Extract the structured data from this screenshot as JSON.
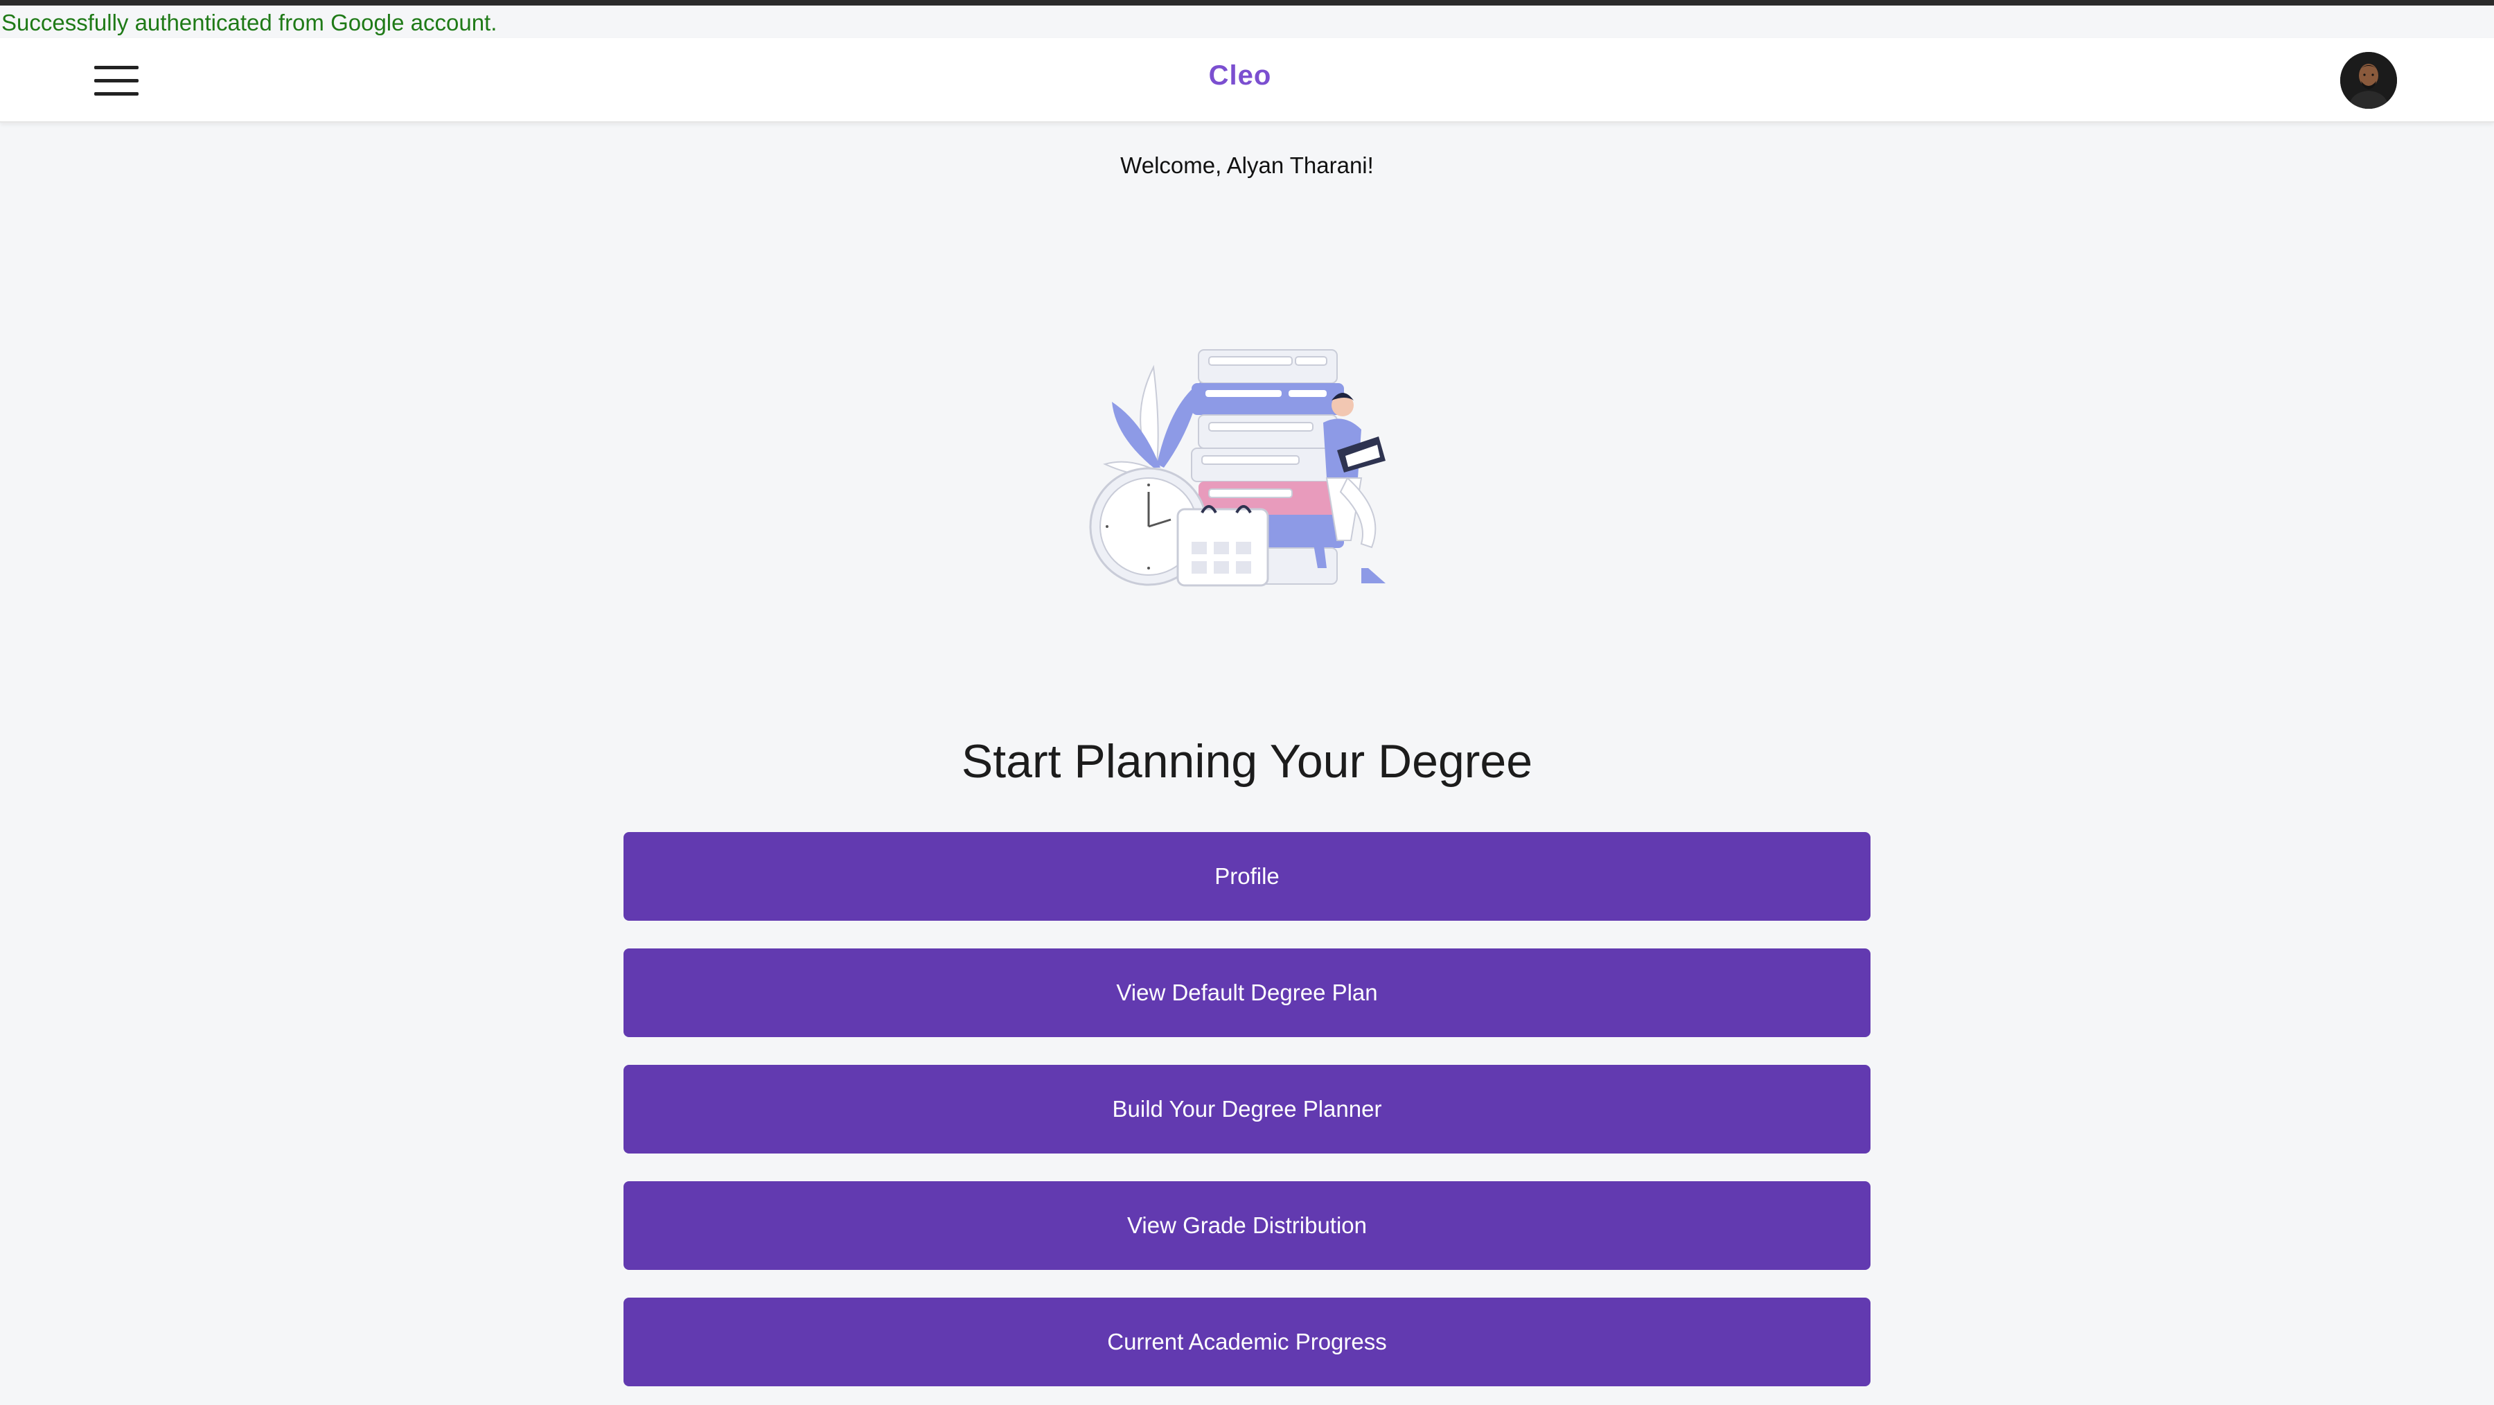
{
  "auth_message": "Successfully authenticated from Google account.",
  "navbar": {
    "brand": "Cleo",
    "menu_icon": "hamburger-menu-icon",
    "avatar_icon": "user-avatar"
  },
  "welcome": "Welcome, Alyan Tharani!",
  "illustration": "study-illustration",
  "heading": "Start Planning Your Degree",
  "actions": [
    {
      "label": "Profile"
    },
    {
      "label": "View Default Degree Plan"
    },
    {
      "label": "Build Your Degree Planner"
    },
    {
      "label": "View Grade Distribution"
    },
    {
      "label": "Current Academic Progress"
    }
  ],
  "colors": {
    "brand": "#7b4fd0",
    "button": "#623ab0",
    "success_text": "#1f7a17",
    "background": "#f5f6f8"
  }
}
